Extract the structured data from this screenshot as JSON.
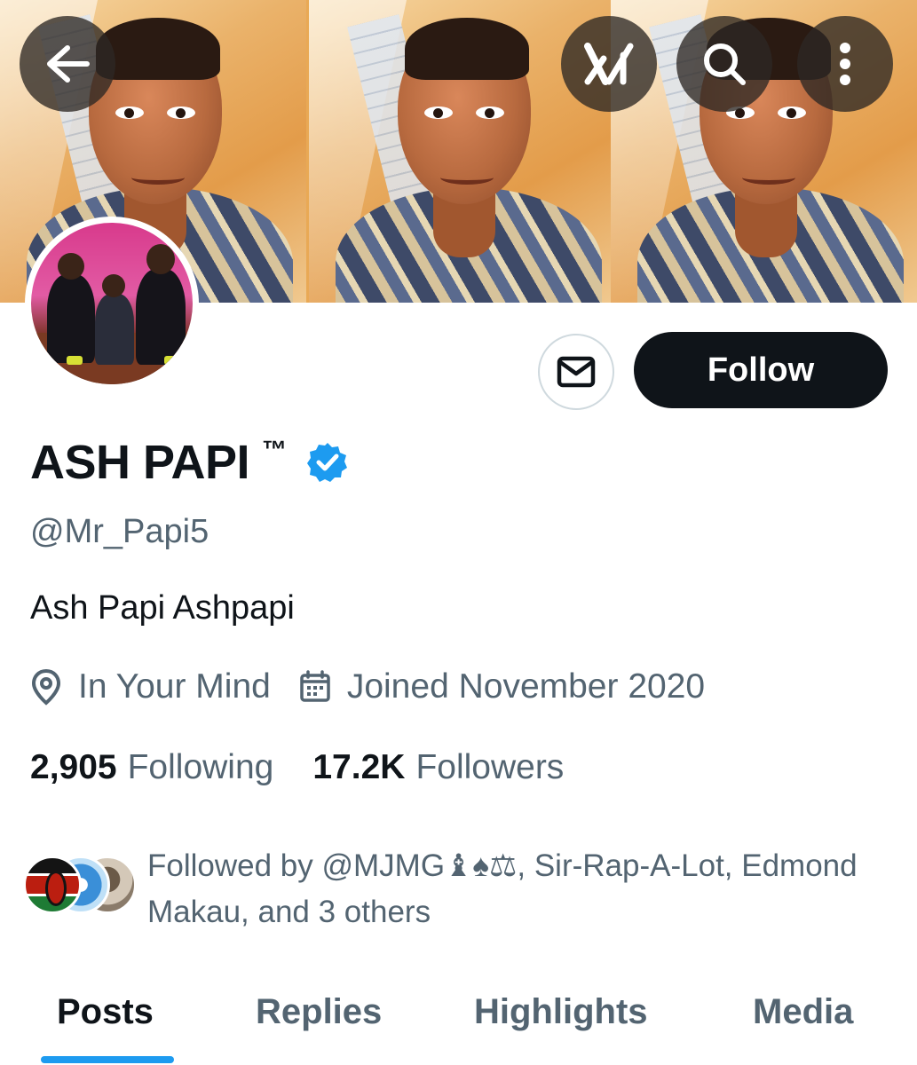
{
  "header": {
    "back_icon": "arrow-left-icon",
    "grok_icon": "grok-icon",
    "search_icon": "search-icon",
    "more_icon": "more-vertical-icon"
  },
  "banner": {
    "description_color": "#e9a955"
  },
  "profile": {
    "display_name": "ASH PAPI",
    "trademark": "™",
    "verified": true,
    "verified_color": "#1d9bf0",
    "handle": "@Mr_Papi5",
    "bio": "Ash Papi Ashpapi",
    "location": "In Your Mind",
    "joined": "Joined November 2020",
    "location_icon": "location-pin-icon",
    "calendar_icon": "calendar-icon"
  },
  "actions": {
    "message_icon": "envelope-icon",
    "follow_label": "Follow"
  },
  "stats": {
    "following_count": "2,905",
    "following_label": "Following",
    "followers_count": "17.2K",
    "followers_label": "Followers"
  },
  "followed_by": {
    "text": "Followed by @MJMG♝♠⚖, Sir-Rap-A-Lot, Edmond Makau, and 3 others"
  },
  "tabs": [
    {
      "label": "Posts",
      "active": true
    },
    {
      "label": "Replies",
      "active": false
    },
    {
      "label": "Highlights",
      "active": false
    },
    {
      "label": "Media",
      "active": false
    }
  ],
  "colors": {
    "text_primary": "#0f1419",
    "text_secondary": "#536471",
    "accent": "#1d9bf0",
    "button_dark": "#0f1419"
  }
}
